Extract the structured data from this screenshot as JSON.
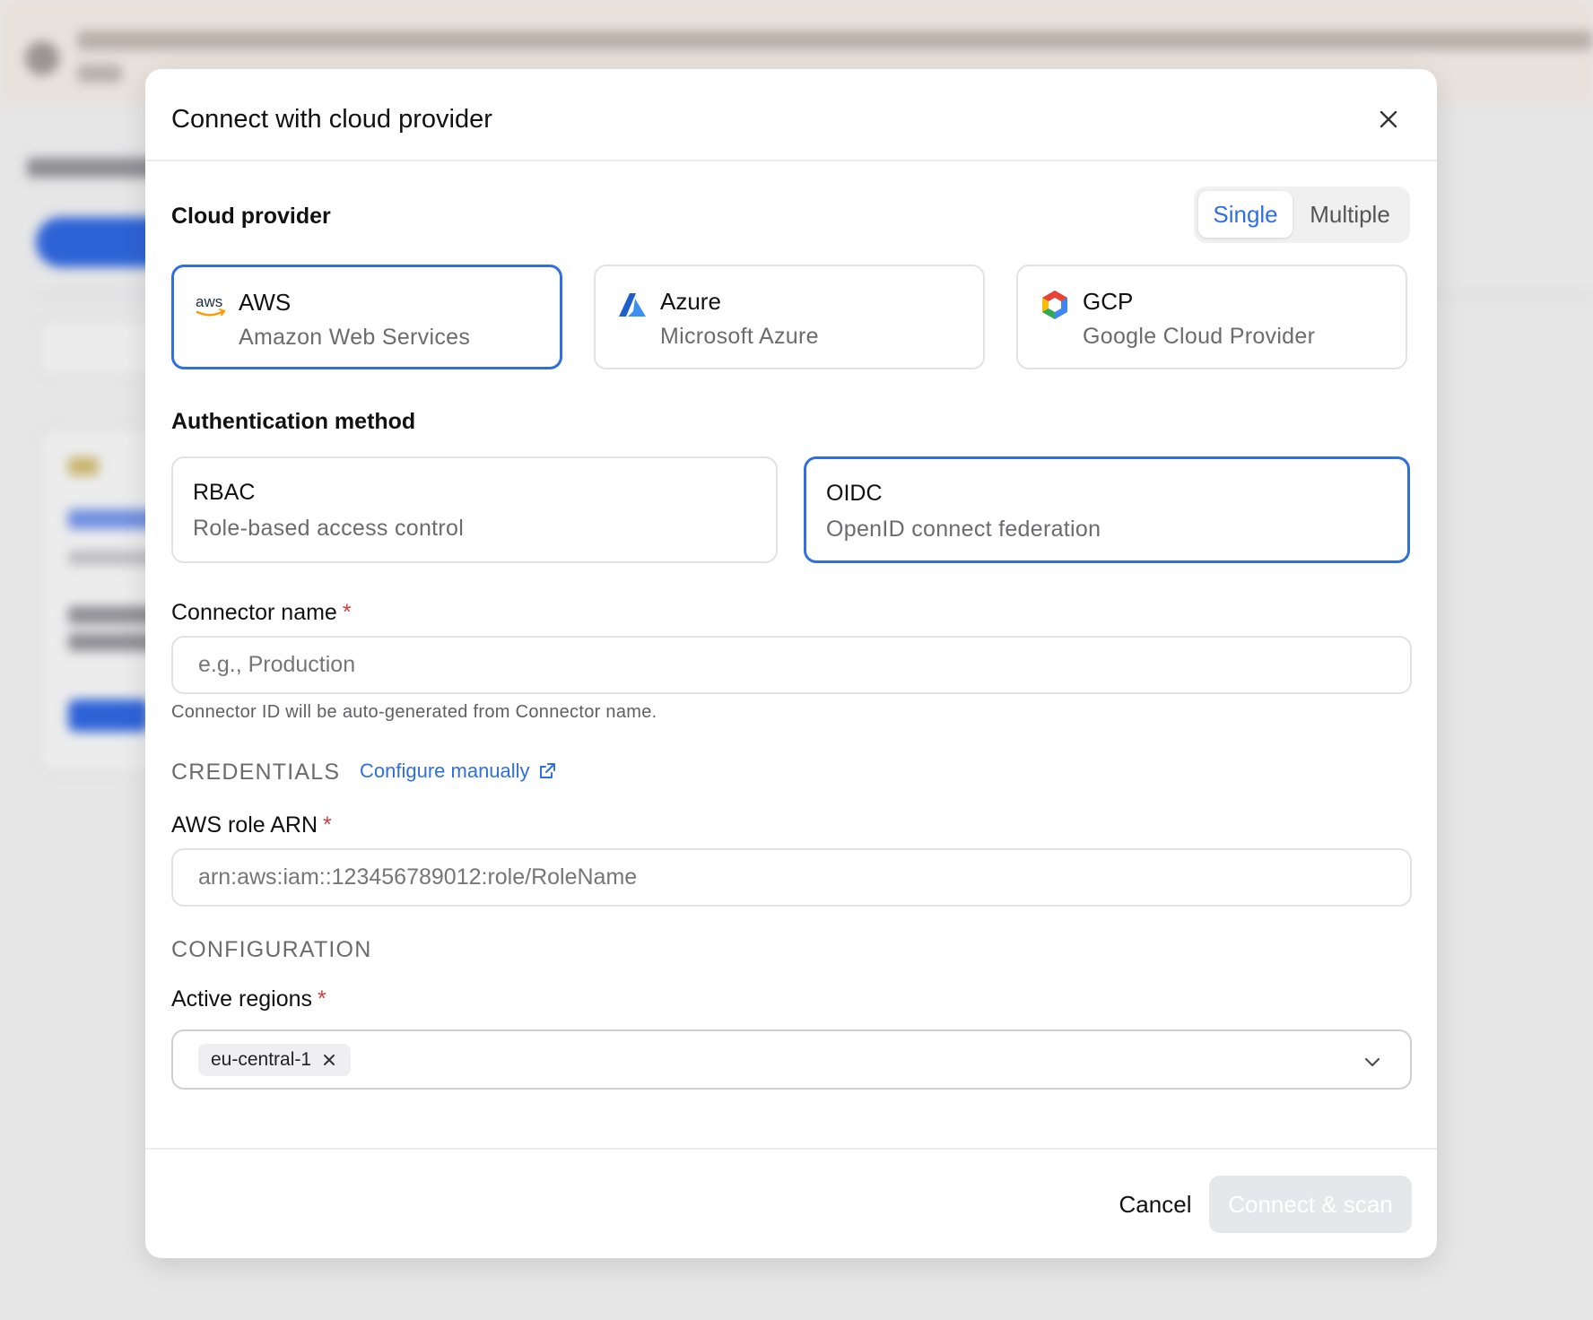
{
  "modal": {
    "title": "Connect with cloud provider"
  },
  "cloud_provider": {
    "label": "Cloud provider",
    "mode_toggle": {
      "options": [
        "Single",
        "Multiple"
      ],
      "selected": "Single"
    },
    "providers": [
      {
        "name": "AWS",
        "description": "Amazon Web Services",
        "logo_text": "aws",
        "selected": true
      },
      {
        "name": "Azure",
        "description": "Microsoft Azure",
        "selected": false
      },
      {
        "name": "GCP",
        "description": "Google Cloud Provider",
        "selected": false
      }
    ]
  },
  "auth": {
    "label": "Authentication method",
    "methods": [
      {
        "name": "RBAC",
        "description": "Role-based access control",
        "selected": false
      },
      {
        "name": "OIDC",
        "description": "OpenID connect federation",
        "selected": true
      }
    ]
  },
  "connector_name": {
    "label": "Connector name",
    "required_mark": "*",
    "value": "",
    "placeholder": "e.g., Production",
    "hint": "Connector ID will be auto-generated from Connector name."
  },
  "credentials": {
    "heading": "CREDENTIALS",
    "configure_link": "Configure manually",
    "role_arn": {
      "label": "AWS role ARN",
      "required_mark": "*",
      "value": "",
      "placeholder": "arn:aws:iam::123456789012:role/RoleName"
    }
  },
  "configuration": {
    "heading": "CONFIGURATION",
    "regions": {
      "label": "Active regions",
      "required_mark": "*",
      "selected": [
        "eu-central-1"
      ]
    }
  },
  "footer": {
    "cancel": "Cancel",
    "primary": "Connect & scan"
  },
  "colors": {
    "accent": "#2f6fe0",
    "required": "#d13c3c",
    "disabled_button": "#e6e7ea"
  }
}
